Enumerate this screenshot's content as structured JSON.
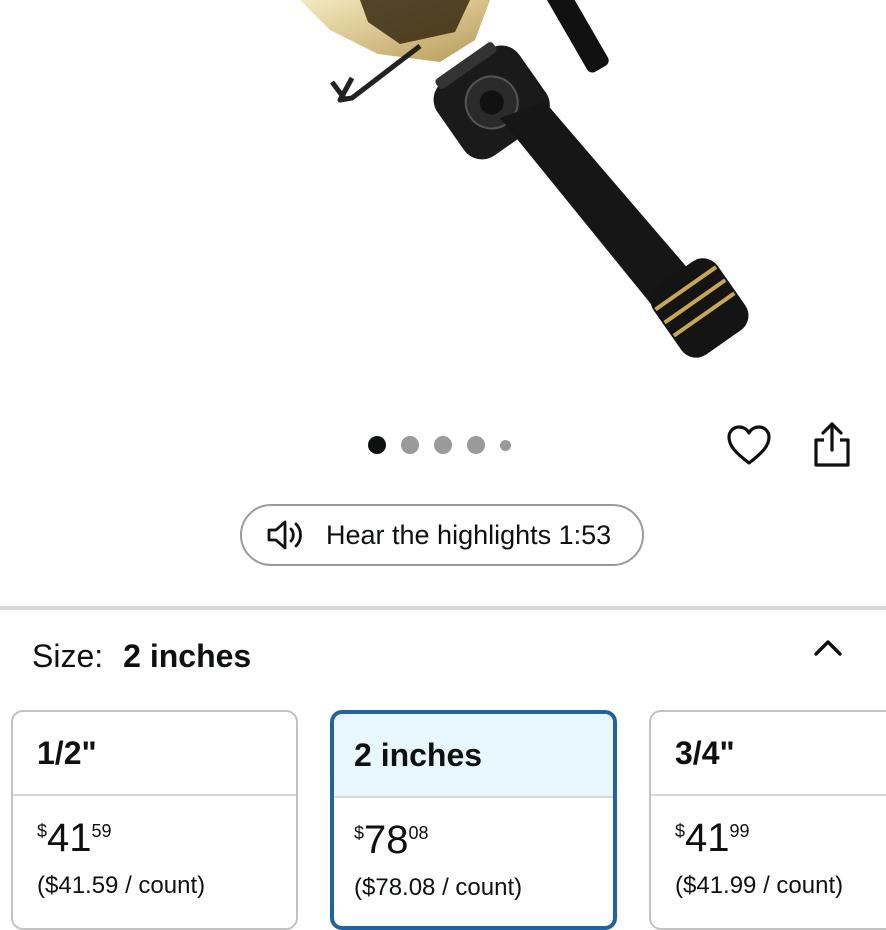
{
  "gallery": {
    "dots": [
      {
        "state": "active"
      },
      {
        "state": "inactive"
      },
      {
        "state": "inactive"
      },
      {
        "state": "inactive"
      },
      {
        "state": "small"
      }
    ]
  },
  "audio": {
    "label": "Hear the highlights 1:53",
    "icon": "speaker-icon"
  },
  "size": {
    "label": "Size:",
    "value": "2 inches",
    "options": [
      {
        "name": "1/2\"",
        "currency": "$",
        "whole": "41",
        "fraction": "59",
        "unit_price": "($41.59 / count)",
        "selected": false
      },
      {
        "name": "2 inches",
        "currency": "$",
        "whole": "78",
        "fraction": "08",
        "unit_price": "($78.08 / count)",
        "selected": true
      },
      {
        "name": "3/4\"",
        "currency": "$",
        "whole": "41",
        "fraction": "99",
        "unit_price": "($41.99 / count)",
        "selected": false
      }
    ]
  },
  "colors": {
    "selected_border": "#2162a1",
    "selected_header_bg": "#e8f6fd",
    "text": "#0f1111"
  }
}
